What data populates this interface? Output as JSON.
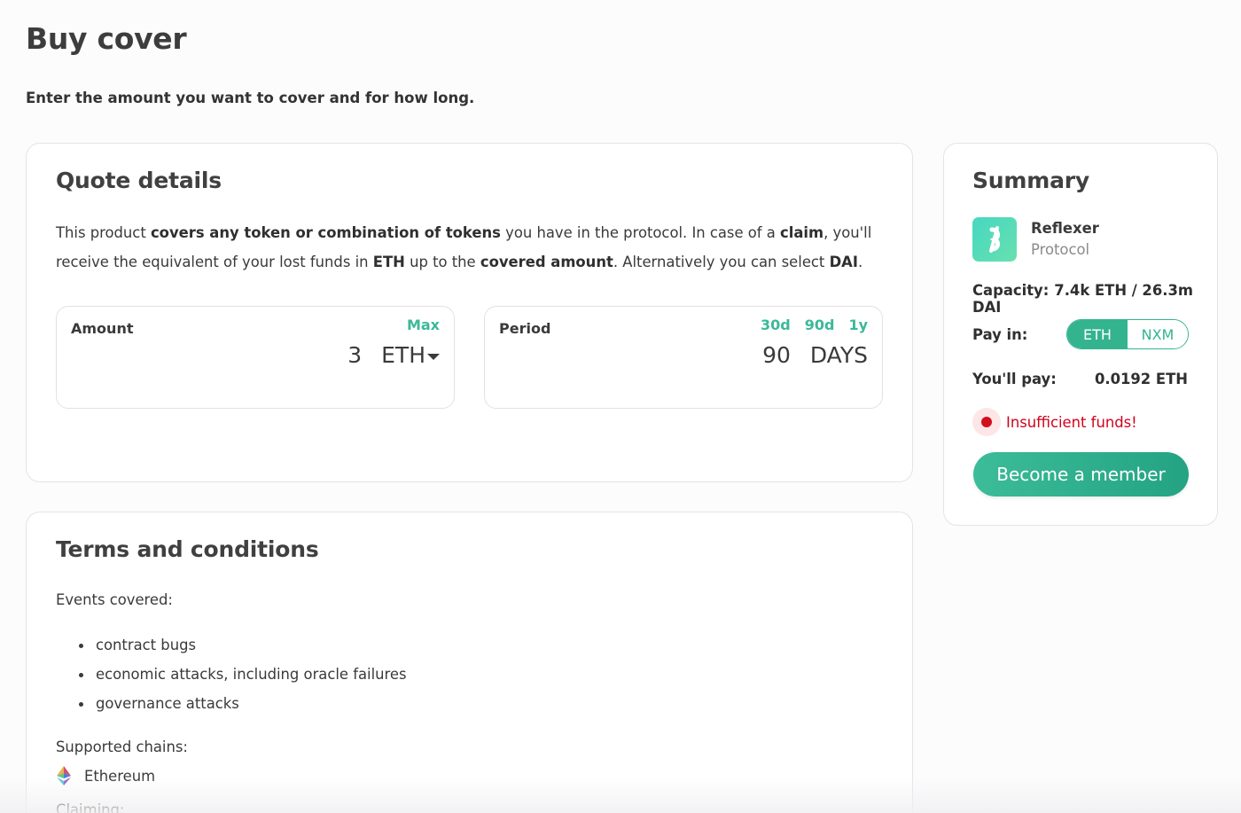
{
  "page": {
    "title": "Buy cover",
    "subtitle": "Enter the amount you want to cover and for how long."
  },
  "quote": {
    "title": "Quote details",
    "description": {
      "t1": "This product ",
      "b1": "covers any token or combination of tokens",
      "t2": " you have in the protocol. In case of a ",
      "b2": "claim",
      "t3": ", you'll receive the equivalent of your lost funds in ",
      "b3": "ETH",
      "t4": " up to the ",
      "b4": "covered amount",
      "t5": ". Alternatively you can select ",
      "b5": "DAI",
      "t6": "."
    },
    "amount": {
      "label": "Amount",
      "max_label": "Max",
      "value": "3",
      "currency": "ETH"
    },
    "period": {
      "label": "Period",
      "options": [
        "30d",
        "90d",
        "1y"
      ],
      "value": "90",
      "unit": "DAYS"
    }
  },
  "terms": {
    "title": "Terms and conditions",
    "events_label": "Events covered:",
    "events": [
      "contract bugs",
      "economic attacks, including oracle failures",
      "governance attacks"
    ],
    "chains_label": "Supported chains:",
    "chains": [
      "Ethereum"
    ],
    "claiming_label": "Claiming:"
  },
  "summary": {
    "title": "Summary",
    "product": {
      "name": "Reflexer",
      "type": "Protocol",
      "logo_icon": "reflexer-logo"
    },
    "capacity_label": "Capacity:",
    "capacity_value": "7.4k ETH / 26.3m DAI",
    "pay_in_label": "Pay in:",
    "pay_in_options": [
      "ETH",
      "NXM"
    ],
    "pay_in_selected": "ETH",
    "you_pay_label": "You'll pay:",
    "you_pay_value": "0.0192 ETH",
    "warning": "Insufficient funds!",
    "cta_label": "Become a member"
  },
  "colors": {
    "accent": "#33b48f",
    "link": "#3cb89a",
    "error": "#d0021b"
  }
}
